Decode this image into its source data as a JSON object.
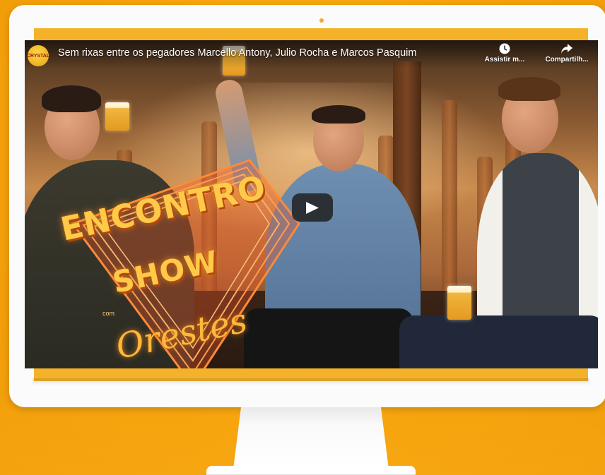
{
  "video": {
    "channel_logo_text": "CRYSTAL",
    "title": "Sem rixas entre os pegadores Marcello Antony, Julio Rocha e Marcos Pasquim",
    "watch_later_label": "Assistir m...",
    "share_label": "Compartilh...",
    "play_icon": "play-icon",
    "thumbnail": {
      "logo_line1": "ENCONTRO",
      "logo_line2": "SHOW",
      "logo_com": "com",
      "logo_line3": "Orestes"
    }
  },
  "colors": {
    "background": "#f6a60e",
    "monitor": "#fbfbfb",
    "play_button": "#212121"
  }
}
